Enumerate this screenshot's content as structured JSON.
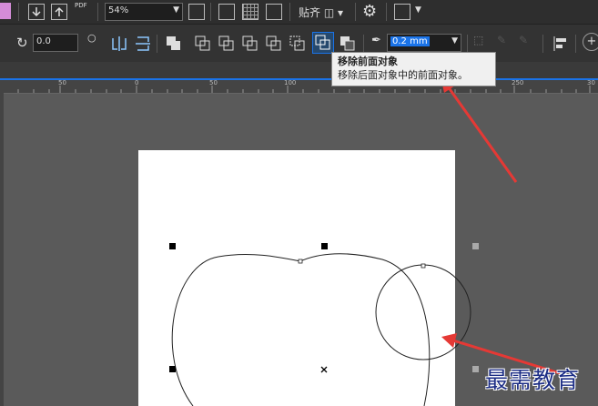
{
  "toolbar_top": {
    "zoom_value": "54%",
    "pdf_label": "PDF",
    "snap_label": "贴齐"
  },
  "toolbar_props": {
    "rotation_value": "0.0",
    "outline_width": "0.2 mm"
  },
  "tooltip": {
    "title": "移除前面对象",
    "description": "移除后面对象中的前面对象。"
  },
  "ruler": {
    "ticks": [
      "50",
      "0",
      "50",
      "100",
      "250",
      "30"
    ]
  },
  "watermark": "最需教育",
  "colors": {
    "accent_blue": "#1a73e8",
    "arrow_red": "#e53935"
  }
}
